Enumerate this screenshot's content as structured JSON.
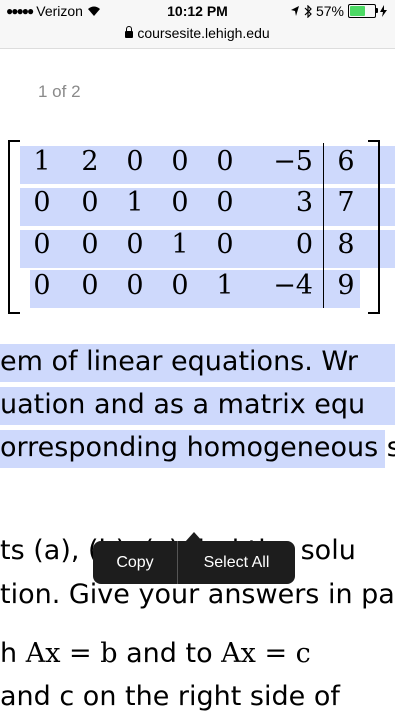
{
  "status_bar": {
    "signal_dots": "●●●●●",
    "carrier": "Verizon",
    "time": "10:12 PM",
    "battery_percent": "57%",
    "battery_level": 0.57
  },
  "url_bar": {
    "domain": "coursesite.lehigh.edu"
  },
  "page_counter": "1 of 2",
  "matrix": {
    "rows": [
      [
        "1",
        "2",
        "0",
        "0",
        "0",
        "−5",
        "6"
      ],
      [
        "0",
        "0",
        "1",
        "0",
        "0",
        "3",
        "7"
      ],
      [
        "0",
        "0",
        "0",
        "1",
        "0",
        "0",
        "8"
      ],
      [
        "0",
        "0",
        "0",
        "0",
        "1",
        "−4",
        "9"
      ]
    ]
  },
  "text": {
    "line1": "em of linear equations.  Wr",
    "line2": "uation and as a matrix equ",
    "line3": "orresponding homogeneous s",
    "line4a": "ts (a), (b), (c) find the solu",
    "line5": "tion.  Give your answers in pa",
    "line6_pre": "h ",
    "line6_math1": "Ax = b",
    "line6_mid": " and to ",
    "line6_math2": "Ax = c",
    "line7": "  and c on the right side of"
  },
  "context_menu": {
    "copy": "Copy",
    "select_all": "Select All"
  },
  "colors": {
    "selection": "#a6bafa",
    "menu_bg": "#1d1d1d",
    "battery": "#4cd964"
  }
}
